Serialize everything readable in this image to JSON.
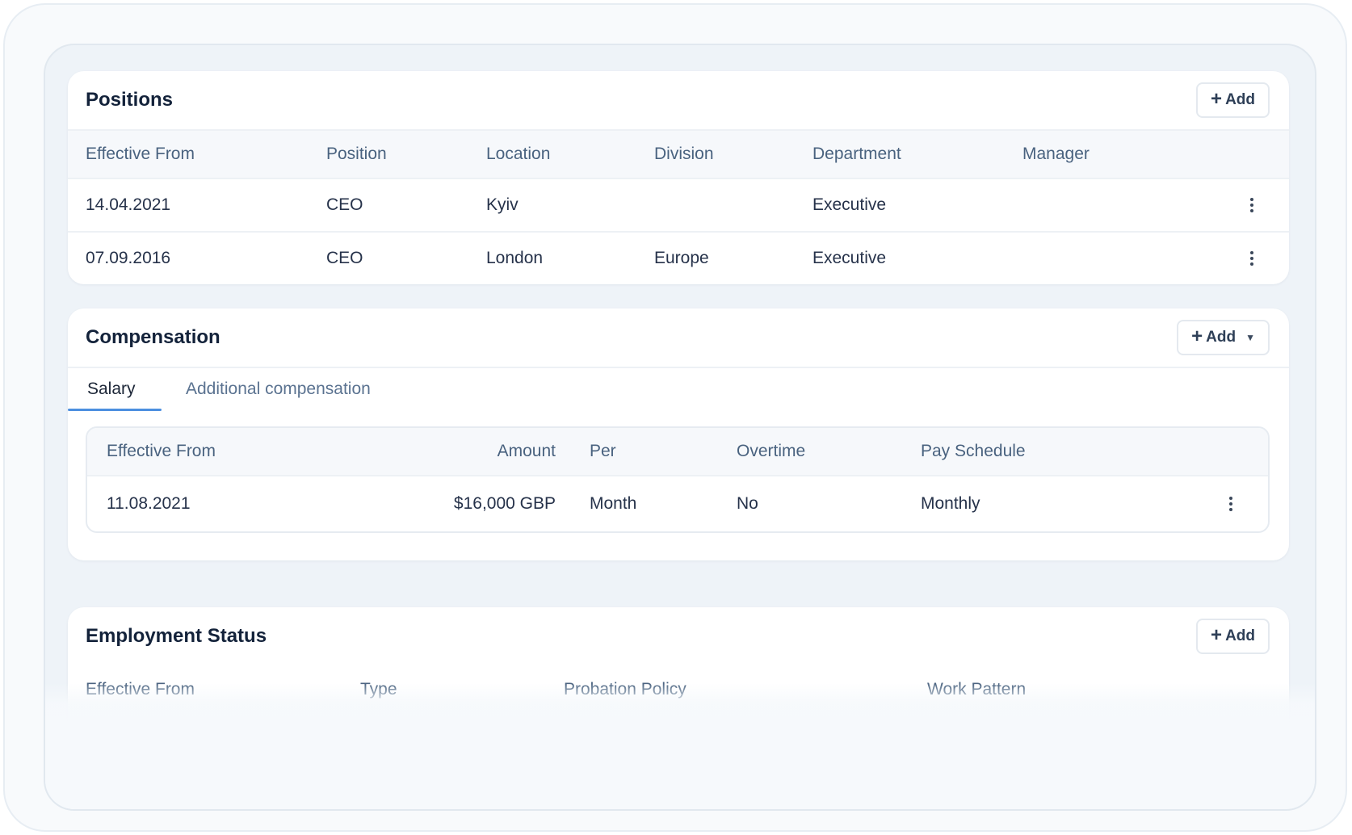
{
  "positions": {
    "title": "Positions",
    "add_label": "Add",
    "columns": [
      "Effective From",
      "Position",
      "Location",
      "Division",
      "Department",
      "Manager"
    ],
    "rows": [
      {
        "effective_from": "14.04.2021",
        "position": "CEO",
        "location": "Kyiv",
        "division": "",
        "department": "Executive",
        "manager": ""
      },
      {
        "effective_from": "07.09.2016",
        "position": "CEO",
        "location": "London",
        "division": "Europe",
        "department": "Executive",
        "manager": ""
      }
    ]
  },
  "compensation": {
    "title": "Compensation",
    "add_label": "Add",
    "tabs": [
      {
        "label": "Salary",
        "active": true
      },
      {
        "label": "Additional compensation",
        "active": false
      }
    ],
    "columns": [
      "Effective From",
      "Amount",
      "Per",
      "Overtime",
      "Pay Schedule"
    ],
    "rows": [
      {
        "effective_from": "11.08.2021",
        "amount": "$16,000 GBP",
        "per": "Month",
        "overtime": "No",
        "pay_schedule": "Monthly"
      }
    ]
  },
  "employment_status": {
    "title": "Employment Status",
    "add_label": "Add",
    "columns": [
      "Effective From",
      "Type",
      "Probation Policy",
      "Work Pattern"
    ]
  },
  "colors": {
    "accent": "#4c8fe0",
    "header_text": "#49627f",
    "body_text": "#26324a",
    "title_text": "#13223a"
  }
}
